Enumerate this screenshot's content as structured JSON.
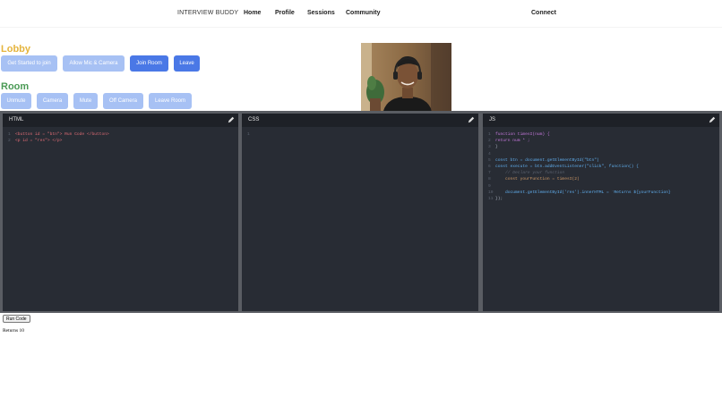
{
  "nav": {
    "brand": "INTERVIEW BUDDY",
    "links": [
      "Home",
      "Profile",
      "Sessions",
      "Community"
    ],
    "connect": "Connect"
  },
  "lobby": {
    "title": "Lobby",
    "title_color": "#e5b43c",
    "buttons": [
      "Get Started to join",
      "Allow Mic & Camera",
      "Join Room",
      "Leave"
    ]
  },
  "room": {
    "title": "Room",
    "title_color": "#4a9a55",
    "buttons": [
      "Unmute",
      "Camera",
      "Mute",
      "Off Camera",
      "Leave Room"
    ]
  },
  "editors": {
    "html": {
      "title": "HTML",
      "lines": [
        "<button id = \"btn\"> Run Code </button>",
        "<p id = \"res\"> </p>"
      ]
    },
    "css": {
      "title": "CSS",
      "lines": [
        ""
      ]
    },
    "js": {
      "title": "JS",
      "lines": [
        "function timesI(num) {",
        "return num * ;",
        "}",
        "",
        "const btn = document.getElementById(\"btn\")",
        "const execute = btn.addEventListener(\"click\", function() {",
        "    // Declare your function",
        "    const yourFunction = timesI(2)",
        "",
        "    document.getElementById('res').innerHTML = `Returns ${yourFunction}",
        "});"
      ]
    }
  },
  "run_button": "Run Code",
  "result": "Returns 10"
}
